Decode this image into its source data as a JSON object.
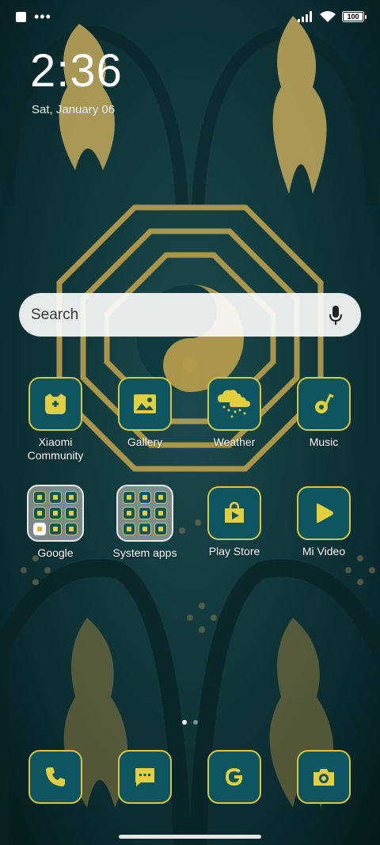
{
  "status_bar": {
    "notification_dots": "•••",
    "battery_level": "100",
    "icons": [
      "notification-square-icon",
      "signal-icon",
      "wifi-icon",
      "battery-icon"
    ]
  },
  "clock": {
    "time": "2:36",
    "date": "Sat, January 06"
  },
  "search": {
    "placeholder": "Search"
  },
  "apps": [
    {
      "label": "Xiaomi\nCommunity",
      "icon": "xiaomi-community-icon"
    },
    {
      "label": "Gallery",
      "icon": "gallery-icon"
    },
    {
      "label": "Weather",
      "icon": "weather-icon"
    },
    {
      "label": "Music",
      "icon": "music-icon"
    },
    {
      "label": "Google",
      "icon": "google-folder-icon"
    },
    {
      "label": "System apps",
      "icon": "system-apps-folder-icon"
    },
    {
      "label": "Play Store",
      "icon": "play-store-icon"
    },
    {
      "label": "Mi Video",
      "icon": "mi-video-icon"
    }
  ],
  "dock": [
    {
      "icon": "phone-icon"
    },
    {
      "icon": "messages-icon"
    },
    {
      "icon": "google-icon"
    },
    {
      "icon": "camera-icon"
    }
  ],
  "page_indicator": {
    "pages": 2,
    "active": 1
  },
  "colors": {
    "icon_background": "#0d5560",
    "icon_accent": "#d8c53a",
    "wallpaper": "#0f3338"
  }
}
